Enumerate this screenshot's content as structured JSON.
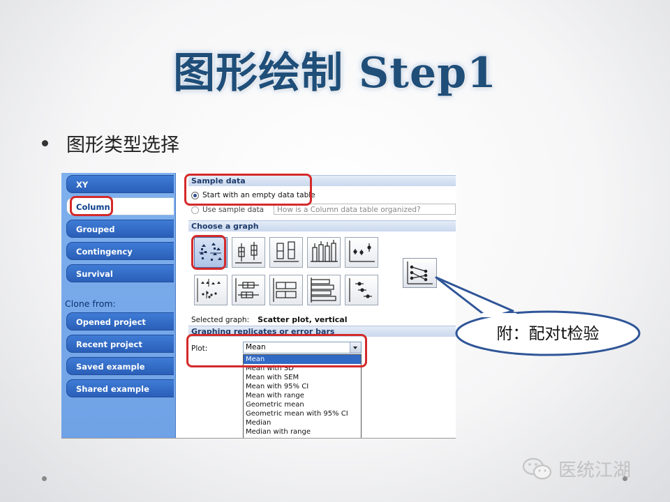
{
  "slide": {
    "title": "图形绘制 Step1",
    "bullet": "图形类型选择"
  },
  "sidebar": {
    "items": [
      "XY",
      "Column",
      "Grouped",
      "Contingency",
      "Survival"
    ],
    "selected": "Column",
    "clone_label": "Clone from:",
    "clone_items": [
      "Opened project",
      "Recent project",
      "Saved example",
      "Shared example"
    ]
  },
  "sample_data": {
    "header": "Sample data",
    "option_empty": "Start with an empty data table",
    "option_sample": "Use sample data",
    "question_placeholder": "How is a Column data table organized?"
  },
  "choose_graph": {
    "header": "Choose a graph",
    "row1_icons": [
      "scatter-vertical-icon",
      "box-whisker-vertical-icon",
      "floating-bars-vertical-icon",
      "column-bars-vertical-icon",
      "mean-error-vertical-icon"
    ],
    "row2_icons": [
      "scatter-horizontal-icon",
      "box-whisker-horizontal-icon",
      "floating-bars-horizontal-icon",
      "bars-horizontal-icon",
      "mean-error-horizontal-icon"
    ],
    "selected_label": "Selected graph:",
    "selected_value": "Scatter plot, vertical",
    "extra_tile_icon": "before-after-icon"
  },
  "replicates": {
    "header": "Graphing replicates or error bars",
    "plot_label": "Plot:",
    "plot_value": "Mean",
    "options": [
      "Mean",
      "Mean with SD",
      "Mean with SEM",
      "Mean with 95% CI",
      "Mean with range",
      "Geometric mean",
      "Geometric mean with 95% CI",
      "Median",
      "Median with range"
    ]
  },
  "callout": {
    "text": "附：配对t检验"
  },
  "watermark": {
    "text": "医统江湖",
    "icon": "wechat-icon"
  },
  "colors": {
    "title": "#1f4e79",
    "highlight_red": "#d42a2a",
    "sidebar_blue": "#2a5fb8",
    "callout_border": "#2f5597"
  }
}
